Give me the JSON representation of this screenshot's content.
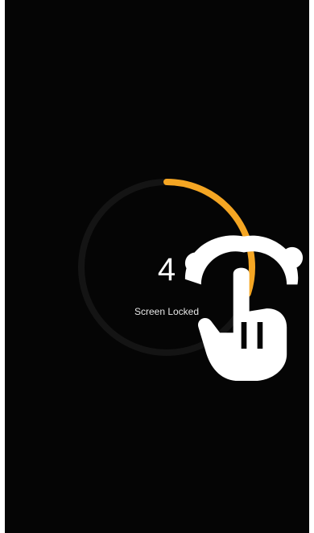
{
  "lock_screen": {
    "countdown_value": "4",
    "status_label": "Screen Locked",
    "progress_fraction": 0.3,
    "icon": "hand-touch-icon",
    "colors": {
      "background": "#050505",
      "track": "#141414",
      "progress": "#f5a623",
      "text": "#ffffff"
    }
  }
}
